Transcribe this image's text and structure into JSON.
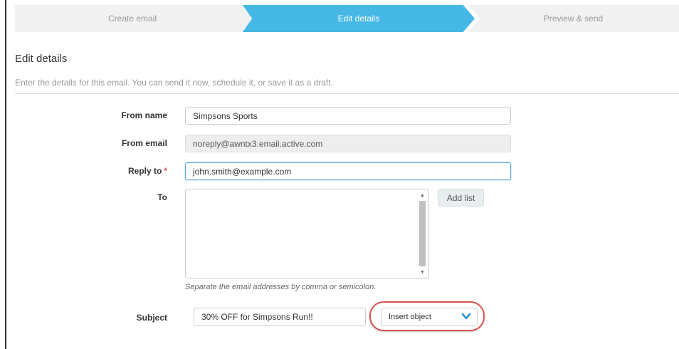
{
  "wizard": {
    "steps": [
      {
        "label": "Create email"
      },
      {
        "label": "Edit details"
      },
      {
        "label": "Preview & send"
      }
    ]
  },
  "page": {
    "title": "Edit details",
    "subtitle": "Enter the details for this email. You can send it now, schedule it, or save it as a draft."
  },
  "form": {
    "from_name": {
      "label": "From name",
      "value": "Simpsons Sports"
    },
    "from_email": {
      "label": "From email",
      "value": "noreply@awntx3.email.active.com"
    },
    "reply_to": {
      "label": "Reply to",
      "required_mark": "*",
      "value": "john.smith@example.com"
    },
    "to": {
      "label": "To",
      "value": "",
      "add_list_label": "Add list",
      "help": "Separate the email addresses by comma or semicolon."
    },
    "subject": {
      "label": "Subject",
      "value": "30% OFF for Simpsons Run!!",
      "insert_object": "Insert object"
    }
  },
  "colors": {
    "active_step": "#46b8e6",
    "highlight": "#d9534f",
    "required": "#d9534f"
  }
}
